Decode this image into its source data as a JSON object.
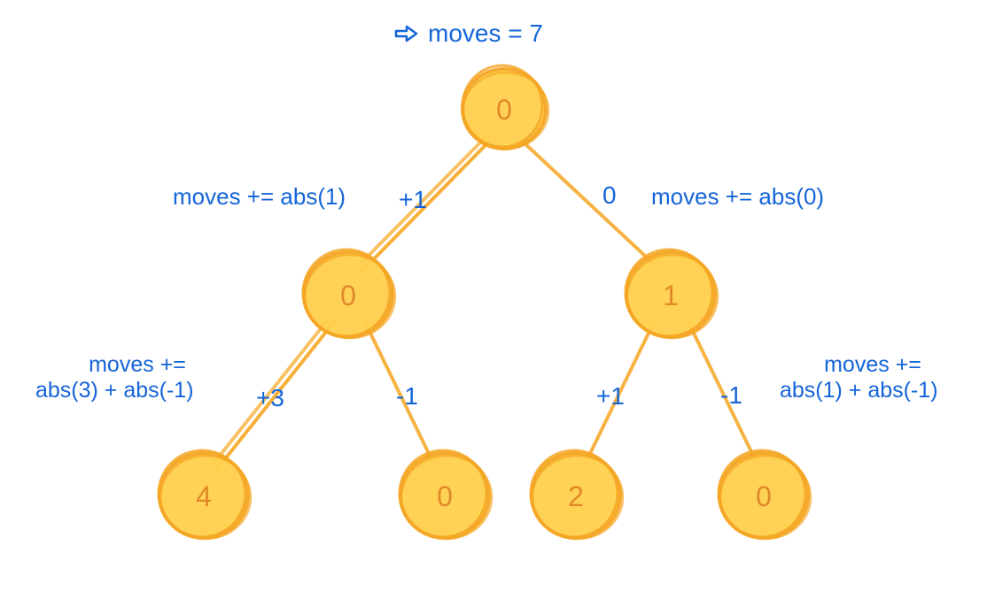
{
  "title": {
    "arrow": "⇨",
    "text": "moves = 7"
  },
  "nodes": {
    "root": "0",
    "left": "0",
    "right": "1",
    "leaf1": "4",
    "leaf2": "0",
    "leaf3": "2",
    "leaf4": "0"
  },
  "edges": {
    "root_left": "+1",
    "root_right": "0",
    "left_leaf1": "+3",
    "left_leaf2": "-1",
    "right_leaf3": "+1",
    "right_leaf4": "-1"
  },
  "annotations": {
    "root_left": "moves += abs(1)",
    "root_right": "moves += abs(0)",
    "left_children_line1": "moves +=",
    "left_children_line2": "abs(3) + abs(-1)",
    "right_children_line1": "moves +=",
    "right_children_line2": "abs(1) + abs(-1)"
  },
  "colors": {
    "node_fill": "#ffd04d",
    "node_stroke": "#f5a623",
    "text_blue": "#1565d8",
    "text_orange": "#e08927"
  }
}
